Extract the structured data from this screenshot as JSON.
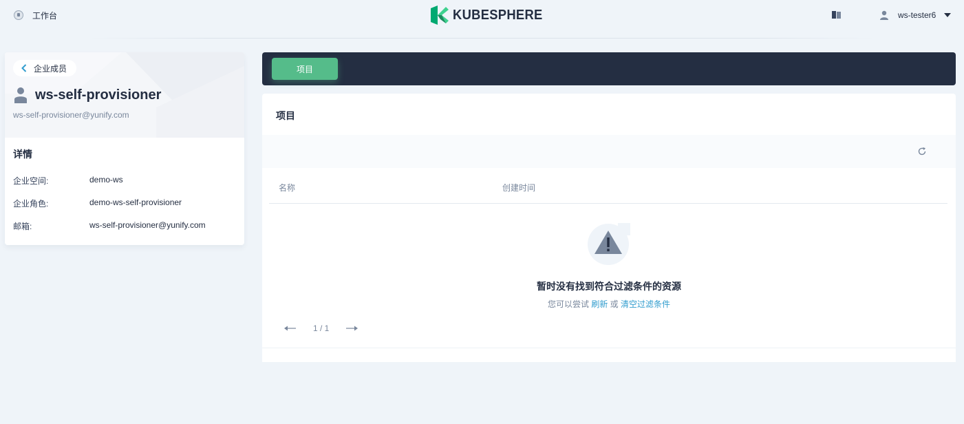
{
  "header": {
    "workbench_label": "工作台",
    "logo_text": "KUBESPHERE",
    "user_name": "ws-tester6"
  },
  "member": {
    "back_label": "企业成员",
    "name": "ws-self-provisioner",
    "email": "ws-self-provisioner@yunify.com",
    "details_title": "详情",
    "details": [
      {
        "key": "企业空间:",
        "value": "demo-ws"
      },
      {
        "key": "企业角色:",
        "value": "demo-ws-self-provisioner"
      },
      {
        "key": "邮箱:",
        "value": "ws-self-provisioner@yunify.com"
      }
    ]
  },
  "tabs": [
    {
      "label": "项目",
      "active": true
    }
  ],
  "panel": {
    "title": "项目",
    "columns": [
      "名称",
      "创建时间"
    ],
    "empty_title": "暂时没有找到符合过滤条件的资源",
    "empty_desc_prefix": "您可以尝试",
    "empty_link_refresh": "刷新",
    "empty_desc_or": "或",
    "empty_link_clear": "清空过滤条件",
    "pagination": "1 / 1"
  },
  "colors": {
    "accent": "#55bc8a",
    "dark": "#242e42",
    "link": "#329dce",
    "background": "#eff4f9"
  },
  "icons": [
    "workbench-icon",
    "kubesphere-logo-icon",
    "docs-icon",
    "user-icon",
    "chevron-down-icon",
    "chevron-left-icon",
    "member-avatar-icon",
    "refresh-icon",
    "warning-icon",
    "arrow-left-icon",
    "arrow-right-icon"
  ]
}
